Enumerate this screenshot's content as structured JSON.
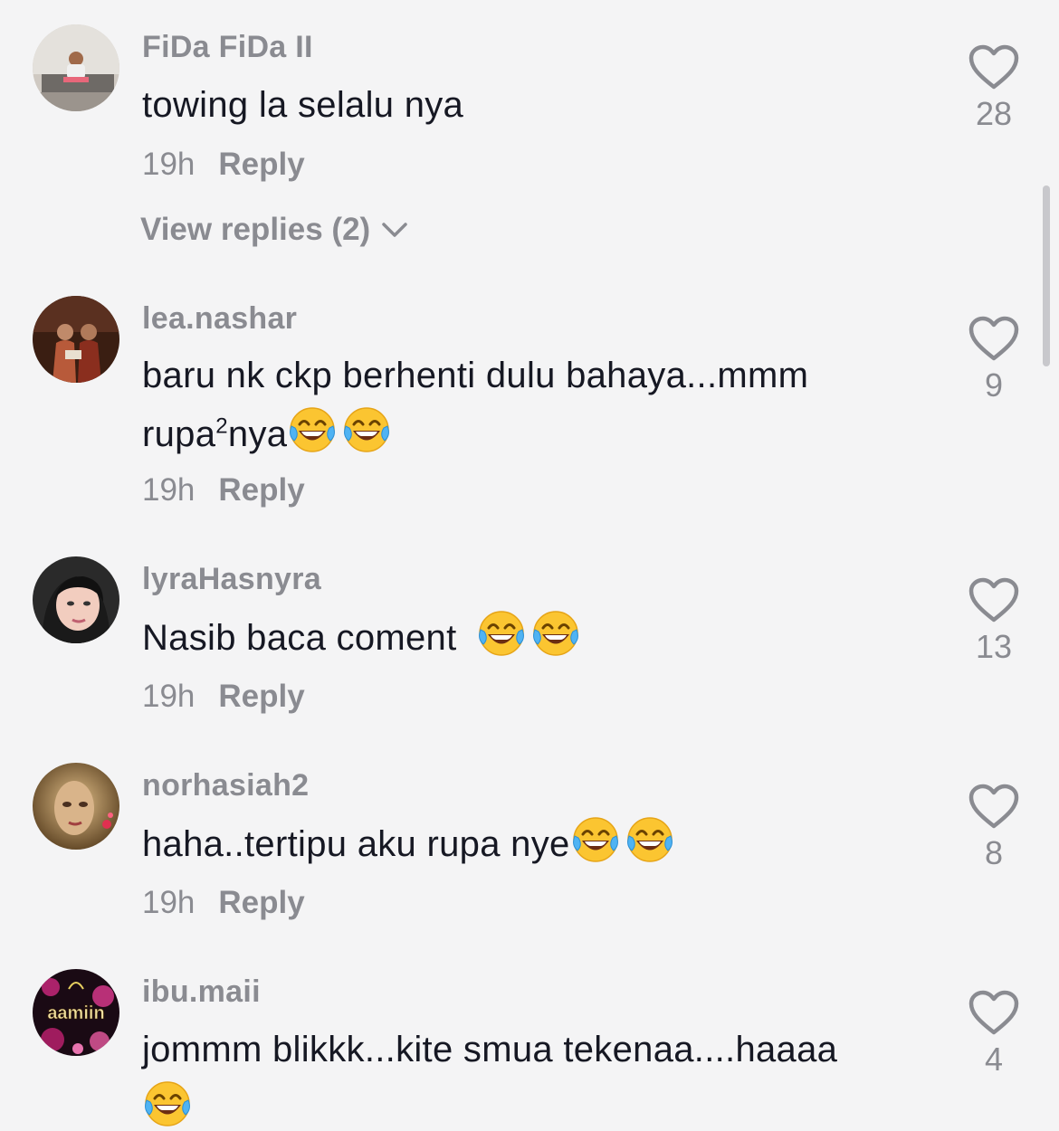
{
  "comments": [
    {
      "username": "FiDa FiDa II",
      "text": "towing la selalu nya",
      "time": "19h",
      "reply": "Reply",
      "likes": "28",
      "view_replies": "View replies (2)"
    },
    {
      "username": "lea.nashar",
      "text_line1": "baru nk ckp berhenti dulu bahaya...mmm",
      "text_line2a": "rupa",
      "text_sup": "2",
      "text_line2b": "nya",
      "time": "19h",
      "reply": "Reply",
      "likes": "9"
    },
    {
      "username": "lyraHasnyra",
      "text": "Nasib baca coment ",
      "time": "19h",
      "reply": "Reply",
      "likes": "13"
    },
    {
      "username": "norhasiah2",
      "text": "haha..tertipu aku rupa nye",
      "time": "19h",
      "reply": "Reply",
      "likes": "8"
    },
    {
      "username": "ibu.maii",
      "text": "jommm blikkk...kite smua tekenaa....haaaa",
      "likes": "4",
      "avatar_text": "aamiin"
    }
  ],
  "icons": {
    "heart": "heart-outline-icon",
    "emoji": "tears-of-joy-emoji",
    "chevron": "chevron-down-icon"
  },
  "colors": {
    "background": "#f4f4f5",
    "text": "#161823",
    "muted": "#8a8b91"
  }
}
